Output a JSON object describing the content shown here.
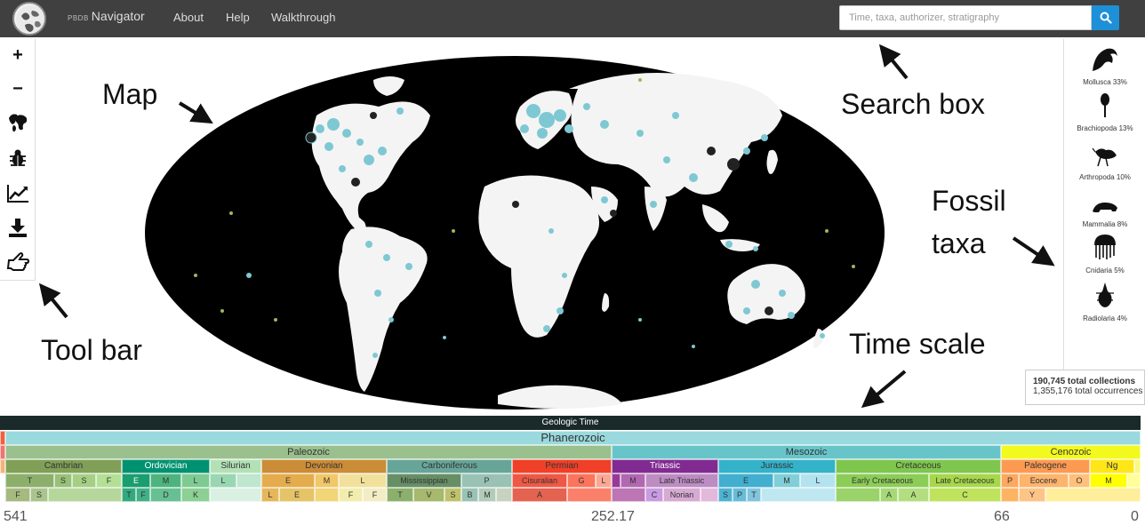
{
  "navbar": {
    "brand_small": "PBDB",
    "brand": "Navigator",
    "links": [
      "About",
      "Help",
      "Walkthrough"
    ],
    "search_placeholder": "Time, taxa, authorizer, stratigraphy"
  },
  "toolbar": {
    "tools": [
      "zoom-in-icon",
      "zoom-out-icon",
      "continents-icon",
      "taxa-icon",
      "trend-chart-icon",
      "download-icon",
      "pointer-hand-icon"
    ],
    "zoom_in": "+",
    "zoom_out": "−"
  },
  "taxa": [
    {
      "name": "Mollusca 33%",
      "icon": "mollusca-icon"
    },
    {
      "name": "Brachiopoda 13%",
      "icon": "brachiopoda-icon"
    },
    {
      "name": "Arthropoda 10%",
      "icon": "arthropoda-icon"
    },
    {
      "name": "Mammalia 8%",
      "icon": "mammalia-icon"
    },
    {
      "name": "Cnidaria 5%",
      "icon": "cnidaria-icon"
    },
    {
      "name": "Radiolaria 4%",
      "icon": "radiolaria-icon"
    }
  ],
  "totals": {
    "collections": "190,745 total collections",
    "occurrences": "1,355,176 total occurrences"
  },
  "annotations": {
    "map": "Map",
    "search_box": "Search box",
    "fossil_line1": "Fossil",
    "fossil_line2": "taxa",
    "time_scale": "Time scale",
    "tool_bar": "Tool bar"
  },
  "timescale": {
    "title": "Geologic Time",
    "eon": "Phanerozoic",
    "eras": [
      "Paleozoic",
      "Mesozoic",
      "Cenozoic"
    ],
    "periods": [
      "Cambrian",
      "Ordovician",
      "Silurian",
      "Devonian",
      "Carboniferous",
      "Permian",
      "Triassic",
      "Jurassic",
      "Cretaceous",
      "Paleogene",
      "Ng"
    ],
    "epochs": [
      "T",
      "S",
      "S",
      "F",
      "E",
      "M",
      "L",
      "L",
      "E",
      "M",
      "L",
      "Mississippian",
      "P",
      "Cisuralian",
      "G",
      "L",
      "M",
      "Late Triassic",
      "E",
      "M",
      "L",
      "Early Cretaceous",
      "Late Cretaceous",
      "P",
      "Eocene",
      "O",
      "M"
    ],
    "ages": [
      "F",
      "S",
      "T",
      "F",
      "D",
      "K",
      "L",
      "E",
      "F",
      "F",
      "T",
      "V",
      "S",
      "B",
      "M",
      "A",
      "C",
      "Norian",
      "S",
      "P",
      "T",
      "A",
      "A",
      "C",
      "Y"
    ],
    "ticks": [
      "541",
      "252.17",
      "66",
      "0"
    ]
  },
  "colors": {
    "navbar": "#404040",
    "search_button": "#1e90d8",
    "ocean": "#000000",
    "land": "#f4f4f4",
    "dot_primary": "#7ec8d3",
    "dot_dark": "#222222",
    "paleozoic": "#99c08d",
    "mesozoic": "#67c5ca",
    "cenozoic": "#f2f91d",
    "phanerozoic": "#9ad9dd"
  }
}
